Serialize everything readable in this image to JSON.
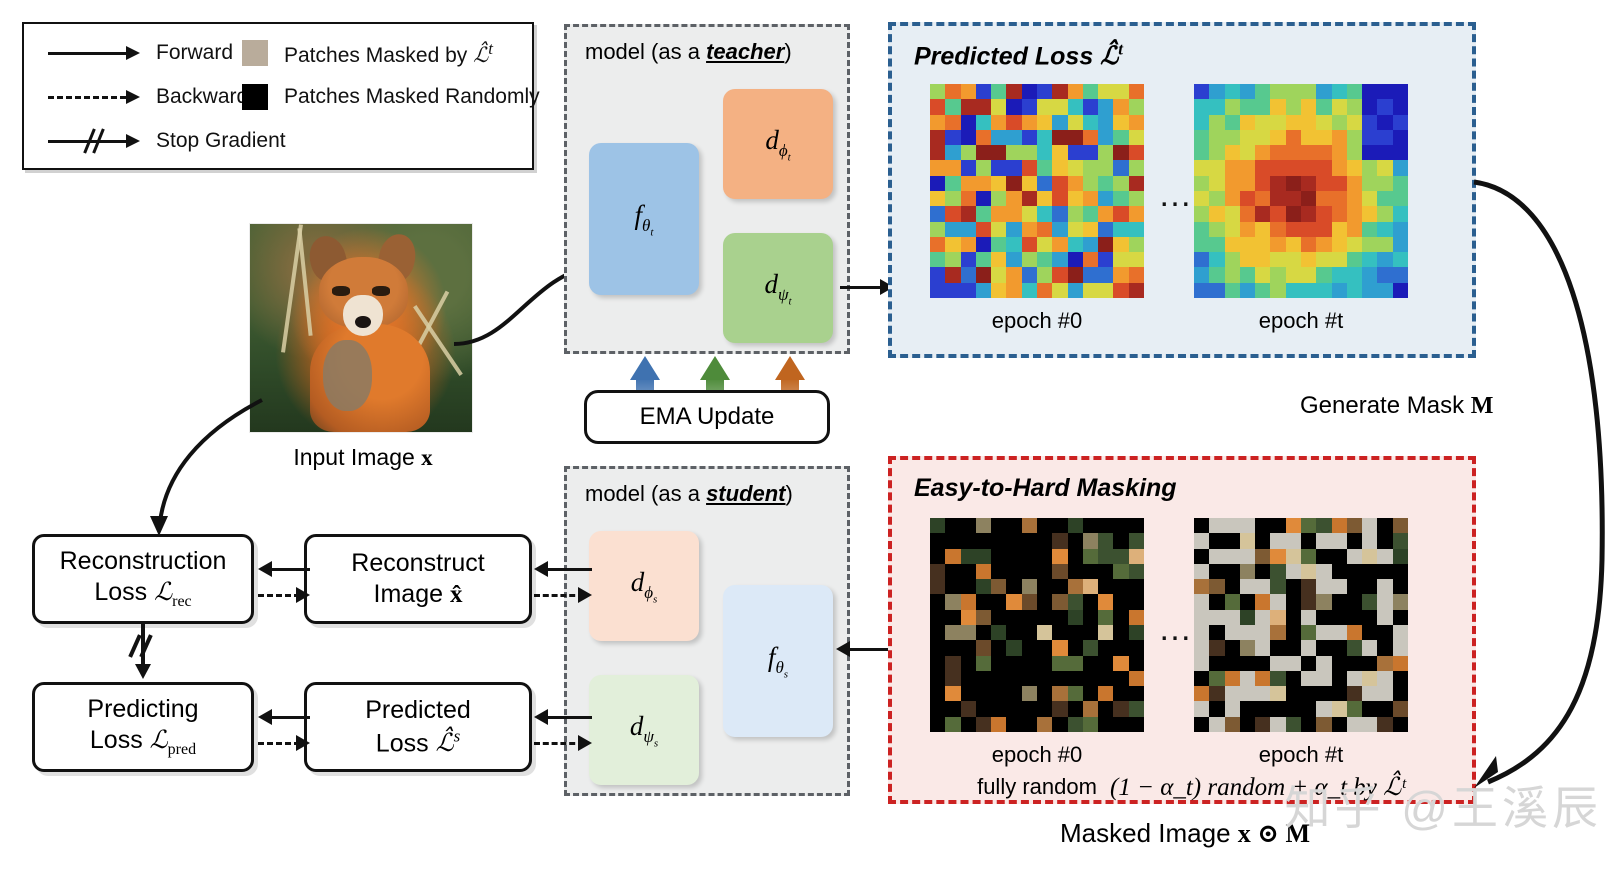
{
  "legend": {
    "rows": [
      {
        "icon": "solid-arrow-icon",
        "label": "Forward"
      },
      {
        "icon": "dashed-arrow-icon",
        "label": "Backward"
      },
      {
        "icon": "stop-gradient-arrow-icon",
        "label": "Stop Gradient"
      }
    ],
    "swatches": [
      {
        "color": "#b9ac9b",
        "label": "Patches Masked by L̂ᵗ",
        "label_main": "Patches Masked by",
        "math": "ℒ̂",
        "sup": "t"
      },
      {
        "color": "#000000",
        "label": "Patches Masked Randomly",
        "label_main": "Patches Masked Randomly",
        "math": "",
        "sup": ""
      }
    ]
  },
  "input": {
    "caption_text": "Input Image",
    "caption_math": "x"
  },
  "teacher": {
    "title_prefix": "model (as a ",
    "title_role": "teacher",
    "title_suffix": ")",
    "units": [
      {
        "name": "f_theta_t",
        "base": "f",
        "sub": "θt",
        "color": "#9dc3e6"
      },
      {
        "name": "d_phi_t",
        "base": "d",
        "sub": "φt",
        "color": "#f4b183"
      },
      {
        "name": "d_psi_t",
        "base": "d",
        "sub": "ψt",
        "color": "#a9d18e"
      }
    ]
  },
  "student": {
    "title_prefix": "model (as a ",
    "title_role": "student",
    "title_suffix": ")",
    "units": [
      {
        "name": "d_phi_s",
        "base": "d",
        "sub": "φs",
        "color": "#fbe0d1"
      },
      {
        "name": "d_psi_s",
        "base": "d",
        "sub": "ψs",
        "color": "#e2efda"
      },
      {
        "name": "f_theta_s",
        "base": "f",
        "sub": "θs",
        "color": "#dce9f7"
      }
    ]
  },
  "ema": {
    "label": "EMA Update",
    "arrow_colors": [
      "#3f72b0",
      "#4e8b3a",
      "#c0651f"
    ]
  },
  "loss_panel": {
    "title_text": "Predicted Loss",
    "title_math": "ℒ̂",
    "title_sup": "t",
    "border_color": "#2b5f90",
    "fill_color": "#e7eef4",
    "tiles": [
      {
        "name": "heatmap-epoch-0",
        "caption": "epoch #0"
      },
      {
        "name": "heatmap-epoch-t",
        "caption": "epoch #t"
      }
    ],
    "ellipsis": "…"
  },
  "mask_panel": {
    "title": "Easy-to-Hard Masking",
    "border_color": "#cc2222",
    "fill_color": "#fae9e7",
    "tiles": [
      {
        "name": "masked-epoch-0",
        "caption": "epoch #0",
        "sub_caption": "fully random"
      },
      {
        "name": "masked-epoch-t",
        "caption": "epoch #t",
        "sub_caption": ""
      }
    ],
    "formula": "(1 − α_t) random + α_t by ℒ̂ᵗ",
    "ellipsis": "…"
  },
  "flow": {
    "recon_loss": {
      "line1": "Reconstruction",
      "line2_text": "Loss",
      "line2_math": "ℒ",
      "line2_sub": "rec"
    },
    "recon_image": {
      "line1": "Reconstruct",
      "line2_text": "Image",
      "line2_math": "x̂"
    },
    "pred_loss_box": {
      "line1": "Predicting",
      "line2_text": "Loss",
      "line2_math": "ℒ",
      "line2_sub": "pred"
    },
    "pred_loss_s": {
      "line1": "Predicted",
      "line2_text": "Loss",
      "line2_math": "ℒ̂",
      "line2_sup": "s"
    }
  },
  "labels": {
    "generate_mask_text": "Generate Mask",
    "generate_mask_math": "M",
    "masked_image_text": "Masked Image",
    "masked_image_math": "x ⊙ M"
  },
  "watermark": "知乎 @王溪辰"
}
